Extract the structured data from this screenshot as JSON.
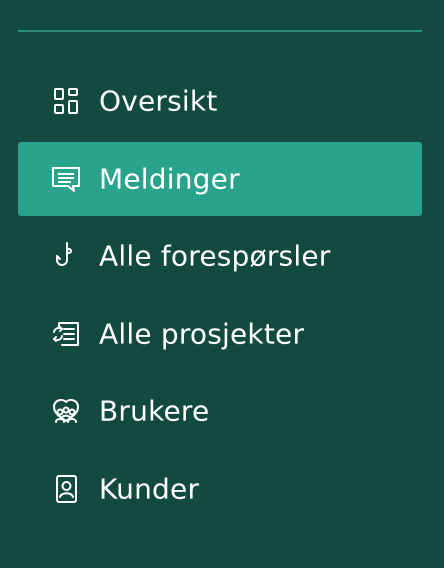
{
  "colors": {
    "background": "#134a3f",
    "active_background": "#29a38c",
    "divider": "#2c8a76",
    "text": "#ffffff"
  },
  "nav": {
    "items": [
      {
        "label": "Oversikt",
        "icon": "dashboard-icon",
        "active": false
      },
      {
        "label": "Meldinger",
        "icon": "message-icon",
        "active": true
      },
      {
        "label": "Alle forespørsler",
        "icon": "fishhook-icon",
        "active": false
      },
      {
        "label": "Alle prosjekter",
        "icon": "sync-list-icon",
        "active": false
      },
      {
        "label": "Brukere",
        "icon": "users-icon",
        "active": false
      },
      {
        "label": "Kunder",
        "icon": "contact-icon",
        "active": false
      }
    ]
  }
}
